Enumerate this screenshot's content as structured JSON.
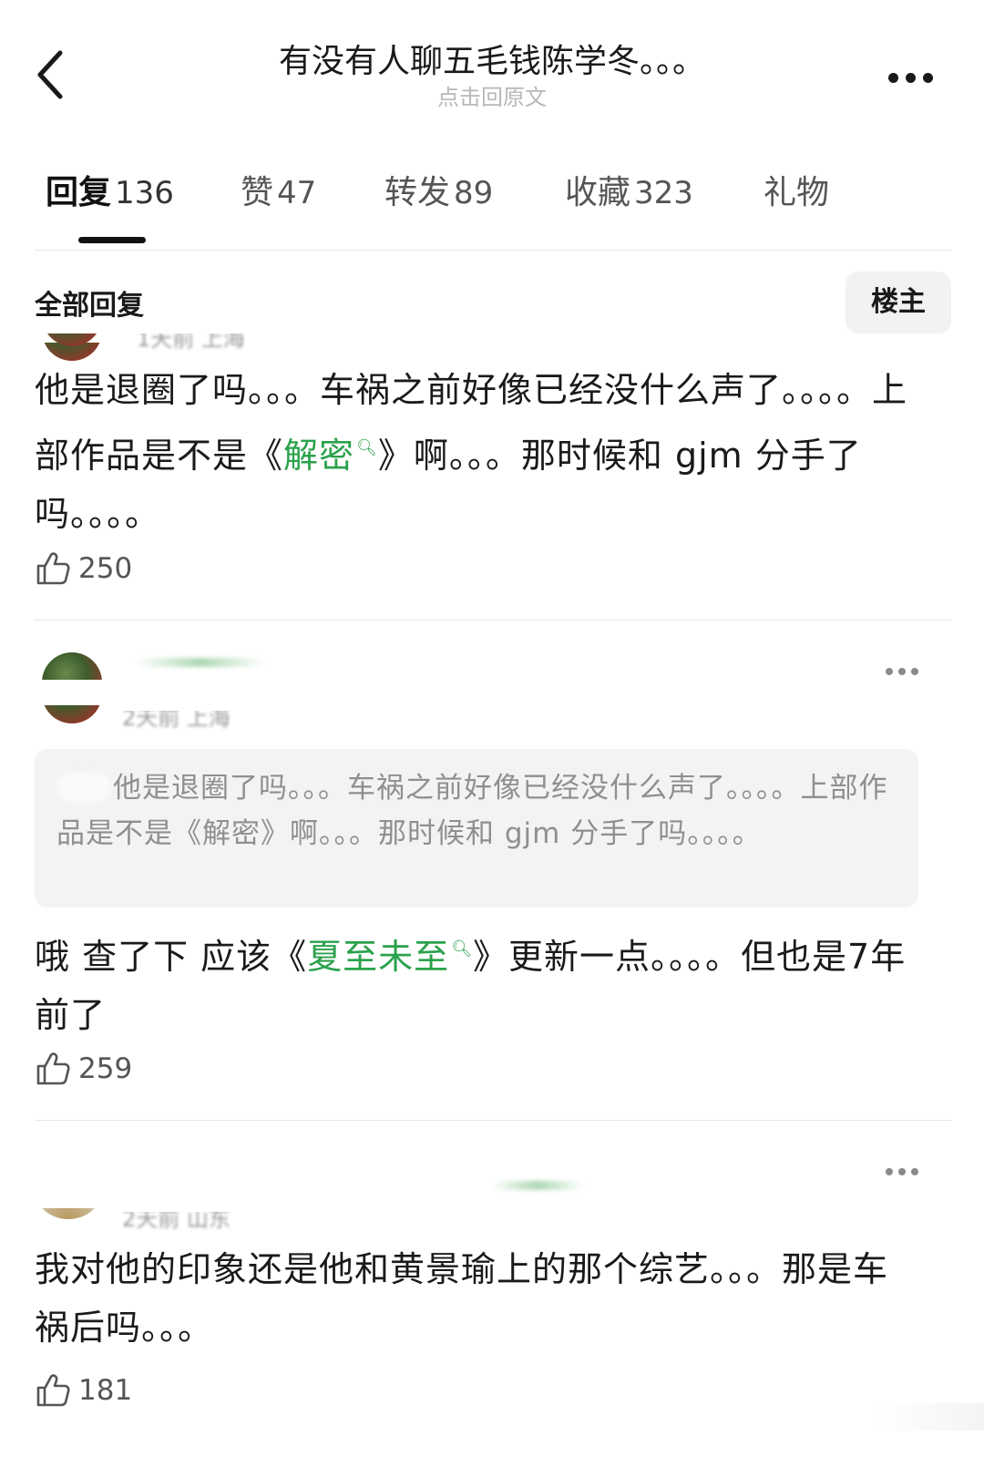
{
  "header": {
    "title": "有没有人聊五毛钱陈学冬。。。",
    "subtitle": "点击回原文"
  },
  "tabs": [
    {
      "label": "回复",
      "count": "136",
      "active": true
    },
    {
      "label": "赞",
      "count": "47",
      "active": false
    },
    {
      "label": "转发",
      "count": "89",
      "active": false
    },
    {
      "label": "收藏",
      "count": "323",
      "active": false
    },
    {
      "label": "礼物",
      "count": "",
      "active": false
    }
  ],
  "section": {
    "title": "全部回复",
    "filter_label": "楼主"
  },
  "comments": [
    {
      "meta": "1天前 上海",
      "text_a": "他是退圈了吗。。。车祸之前好像已经没什么声了。。。。上部作品是不是《",
      "link": "解密",
      "text_b": "》啊。。。那时候和 gjm 分手了吗。。。。",
      "likes": "250"
    },
    {
      "meta": "2天前 上海",
      "quote": "他是退圈了吗。。。车祸之前好像已经没什么声了。。。。上部作品是不是《解密》啊。。。那时候和 gjm 分手了吗。。。。",
      "text_a": "哦 查了下 应该《",
      "link": "夏至未至",
      "text_b": "》更新一点。。。。但也是7年前了",
      "likes": "259"
    },
    {
      "meta": "2天前 山东",
      "text_a": "我对他的印象还是他和黄景瑜上的那个综艺。。。那是车祸后吗。。。",
      "likes": "181"
    }
  ],
  "colors": {
    "accent_link": "#2ba24c",
    "text_primary": "#1a1a1a",
    "text_secondary": "#8f8f8f",
    "quote_bg": "#f3f3f3"
  },
  "icons": {
    "back": "chevron-left-icon",
    "more": "more-horizontal-icon",
    "like": "thumbs-up-icon",
    "search_hint": "magnifier-icon"
  }
}
